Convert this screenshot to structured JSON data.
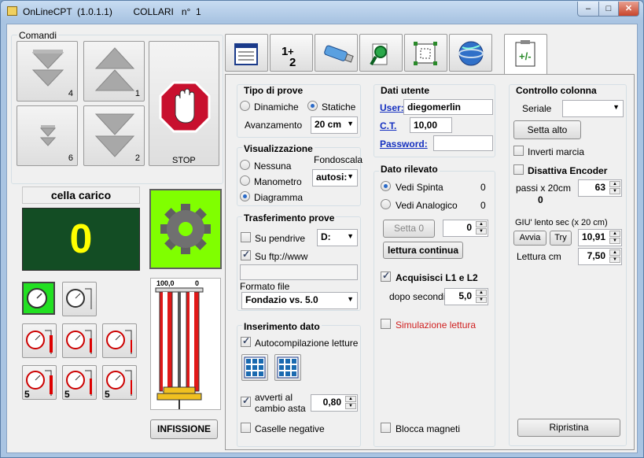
{
  "window": {
    "title": "OnLineCPT  (1.0.1.1)        COLLARI   n°  1",
    "min": "–",
    "max": "□",
    "close": "✕"
  },
  "comandi": {
    "title": "Comandi",
    "btn1": "4",
    "btn2": "1",
    "btn3": "6",
    "btn4": "2",
    "stop": "STOP"
  },
  "cella": {
    "title": "cella carico",
    "value": "0"
  },
  "infissione": {
    "label": "INFISSIONE",
    "scale_left": "100,0",
    "scale_right": "0"
  },
  "tabs": [
    "list-icon",
    "numbers-icon",
    "usb-icon",
    "search-icon",
    "grid-icon",
    "globe-icon",
    "calc-icon"
  ],
  "tipo": {
    "title": "Tipo di prove",
    "opt1": "Dinamiche",
    "opt2": "Statiche",
    "avanz_label": "Avanzamento",
    "avanz_value": "20 cm"
  },
  "visual": {
    "title": "Visualizzazione",
    "opt1": "Nessuna",
    "opt2": "Manometro",
    "opt3": "Diagramma",
    "fondo_label": "Fondoscala",
    "fondo_value": "autosi:"
  },
  "trasf": {
    "title": "Trasferimento prove",
    "pen_label": "Su pendrive",
    "drive": "D:",
    "ftp_label": "Su ftp://www",
    "formato_label": "Formato file",
    "formato_value": "Fondazio vs. 5.0"
  },
  "ins": {
    "title": "Inserimento dato",
    "auto_label": "Autocompilazione letture",
    "avverti_label1": "avverti al",
    "avverti_label2": "cambio asta",
    "avverti_value": "0,80",
    "caselle_label": "Caselle negative"
  },
  "utente": {
    "title": "Dati utente",
    "user_label": "User:",
    "user_value": "diegomerlin",
    "ct_label": "C.T.",
    "ct_value": "10,00",
    "pwd_label": "Password:"
  },
  "rilevato": {
    "title": "Dato rilevato",
    "spinta_label": "Vedi Spinta",
    "spinta_value": "0",
    "analog_label": "Vedi Analogico",
    "analog_value": "0",
    "setta0": "Setta 0",
    "spin_value": "0",
    "lettura": "lettura continua",
    "acq_label": "Acquisisci L1 e L2",
    "dopo_label": "dopo secondi",
    "dopo_value": "5,0",
    "sim_label": "Simulazione lettura",
    "blocca_label": "Blocca magneti"
  },
  "colonna": {
    "title": "Controllo colonna",
    "seriale_label": "Seriale",
    "setta_alto": "Setta alto",
    "inverti_label": "Inverti marcia",
    "disattiva_label": "Disattiva Encoder",
    "passi_label": "passi x 20cm",
    "passi_value": "63",
    "passi_count": "0",
    "giu_label": "GIU' lento sec (x 20 cm)",
    "avvia": "Avvia",
    "try": "Try",
    "giu_value": "10,91",
    "lettura_label": "Lettura cm",
    "lettura_value": "7,50",
    "ripristina": "Ripristina"
  },
  "colors": {
    "display_bg": "#134d24",
    "display_fg": "#ffff00",
    "gear_bg": "#80ff00",
    "stop_red": "#c8102e",
    "sim_red": "#d02020"
  }
}
